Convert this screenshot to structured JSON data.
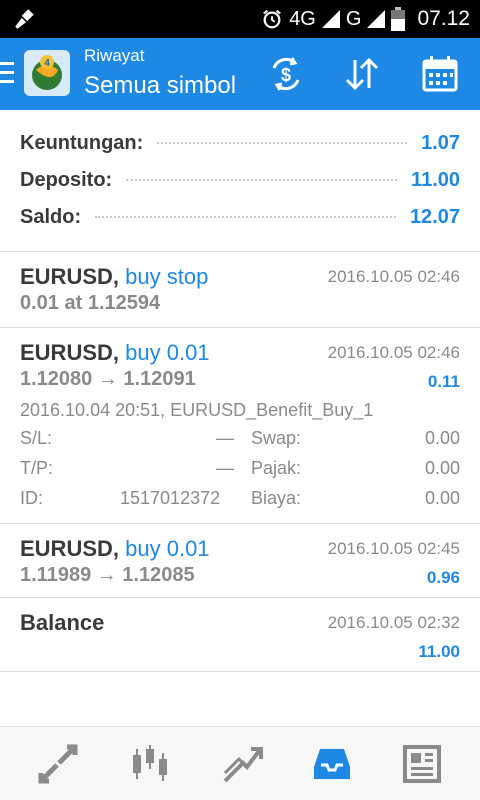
{
  "status_bar": {
    "network_1": "4G",
    "network_2": "G",
    "time": "07.12"
  },
  "app_bar": {
    "subtitle": "Riwayat",
    "title": "Semua simbol",
    "accent_color": "#1e88e5"
  },
  "summary": [
    {
      "label": "Keuntungan:",
      "value": "1.07"
    },
    {
      "label": "Deposito:",
      "value": "11.00"
    },
    {
      "label": "Saldo:",
      "value": "12.07"
    }
  ],
  "trades": [
    {
      "symbol": "EURUSD,",
      "action": "buy stop",
      "date": "2016.10.05 02:46",
      "price_line": "0.01 at 1.12594",
      "profit": ""
    },
    {
      "symbol": "EURUSD,",
      "action": "buy 0.01",
      "date": "2016.10.05 02:46",
      "price_line": "1.12080 → 1.12091",
      "profit": "0.11",
      "details": {
        "comment": "2016.10.04 20:51, EURUSD_Benefit_Buy_1",
        "sl_label": "S/L:",
        "sl_value": "—",
        "tp_label": "T/P:",
        "tp_value": "—",
        "id_label": "ID:",
        "id_value": "1517012372",
        "swap_label": "Swap:",
        "swap_value": "0.00",
        "tax_label": "Pajak:",
        "tax_value": "0.00",
        "fee_label": "Biaya:",
        "fee_value": "0.00"
      }
    },
    {
      "symbol": "EURUSD,",
      "action": "buy 0.01",
      "date": "2016.10.05 02:45",
      "price_line": "1.11989 → 1.12085",
      "profit": "0.96"
    },
    {
      "symbol": "Balance",
      "action": "",
      "date": "2016.10.05 02:32",
      "price_line": "",
      "profit": "11.00"
    }
  ],
  "bottom_nav": {
    "items": [
      "quotes-icon",
      "chart-icon",
      "trade-icon",
      "history-icon",
      "news-icon"
    ],
    "active": "history-icon"
  }
}
